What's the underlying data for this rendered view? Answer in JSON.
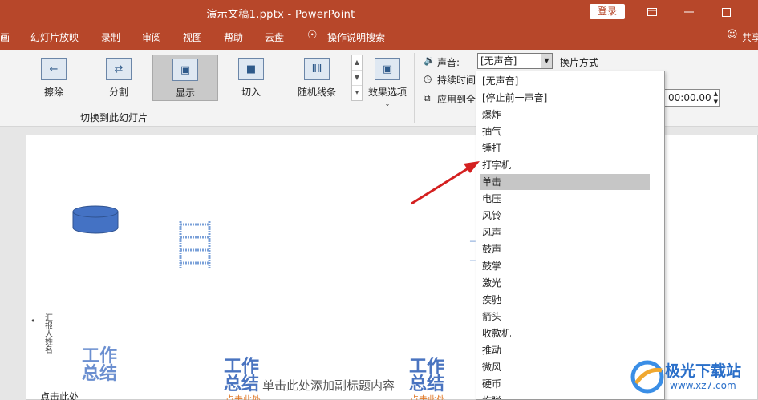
{
  "window": {
    "title": "演示文稿1.pptx  -  PowerPoint",
    "login_label": "登录"
  },
  "menu": {
    "items": [
      "画",
      "幻灯片放映",
      "录制",
      "审阅",
      "视图",
      "帮助",
      "云盘",
      "操作说明搜索"
    ],
    "share_label": "共享"
  },
  "ribbon": {
    "transitions": [
      "擦除",
      "分割",
      "显示",
      "切入",
      "随机线条"
    ],
    "active_transition": "显示",
    "effect_options_label": "效果选项",
    "group_label": "切换到此幻灯片",
    "sound_label": "声音:",
    "sound_value": "[无声音]",
    "duration_label": "持续时间",
    "apply_all_label": "应用到全",
    "advance_label": "换片方式",
    "time_value": "00:00.00"
  },
  "sound_options": [
    "[无声音]",
    "[停止前一声音]",
    "爆炸",
    "抽气",
    "锤打",
    "打字机",
    "单击",
    "电压",
    "风铃",
    "风声",
    "鼓声",
    "鼓掌",
    "激光",
    "疾驰",
    "箭头",
    "收款机",
    "推动",
    "微风",
    "硬币",
    "炸弹"
  ],
  "selected_sound": "单击",
  "slide": {
    "wordart1": "工作\n总结",
    "wordart2": "工作\n总结",
    "wordart3": "工作\n总结",
    "subtitle": "单击此处添加副标题内容",
    "click_here": "点击此处",
    "reporter_label": "汇报\n人姓\n名",
    "orange1": "点击此处",
    "orange2": "点击此处"
  },
  "watermark": {
    "site_name": "极光下载站",
    "url": "www.xz7.com"
  },
  "colors": {
    "titlebar": "#b7472a",
    "wordart": "#4a74c0",
    "arrow": "#d42020"
  }
}
